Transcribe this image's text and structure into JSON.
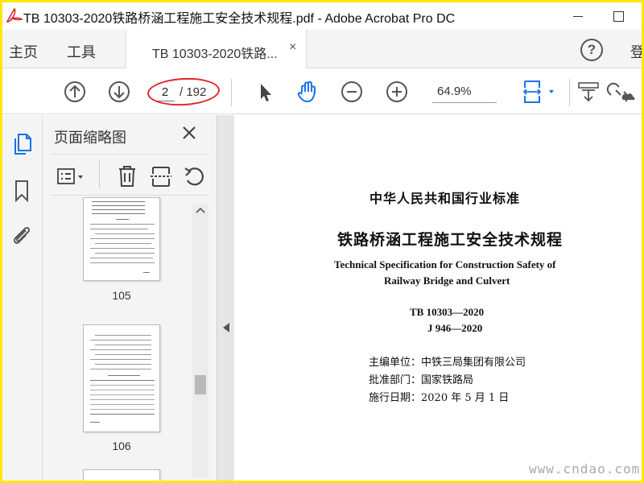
{
  "window": {
    "title": "TB 10303-2020铁路桥涵工程施工安全技术规程.pdf - Adobe Acrobat Pro DC"
  },
  "tabs": {
    "home": "主页",
    "tools": "工具",
    "document": "TB 10303-2020铁路...",
    "close": "×",
    "help": "?",
    "login": "登"
  },
  "toolbar": {
    "current_page": "2",
    "total_pages": "/ 192",
    "zoom": "64.9%"
  },
  "sidebar": {
    "title": "页面缩略图",
    "thumbnails": [
      {
        "label": "105"
      },
      {
        "label": "106"
      }
    ]
  },
  "document": {
    "category": "中华人民共和国行业标准",
    "title_zh": "铁路桥涵工程施工安全技术规程",
    "title_en_line1": "Technical Specification for Construction Safety of",
    "title_en_line2": "Railway Bridge and Culvert",
    "code1": "TB 10303—2020",
    "code2": "J 946—2020",
    "editor": "主编单位：中铁三局集团有限公司",
    "approver": "批准部门：国家铁路局",
    "effective": "施行日期：2020 年 5 月 1 日"
  },
  "watermark": "www.cndao.com",
  "colors": {
    "frame": "#ffe800",
    "annotation_ring": "#e3262b",
    "acrobat_red": "#d7282f",
    "icon_blue": "#1473e6"
  }
}
